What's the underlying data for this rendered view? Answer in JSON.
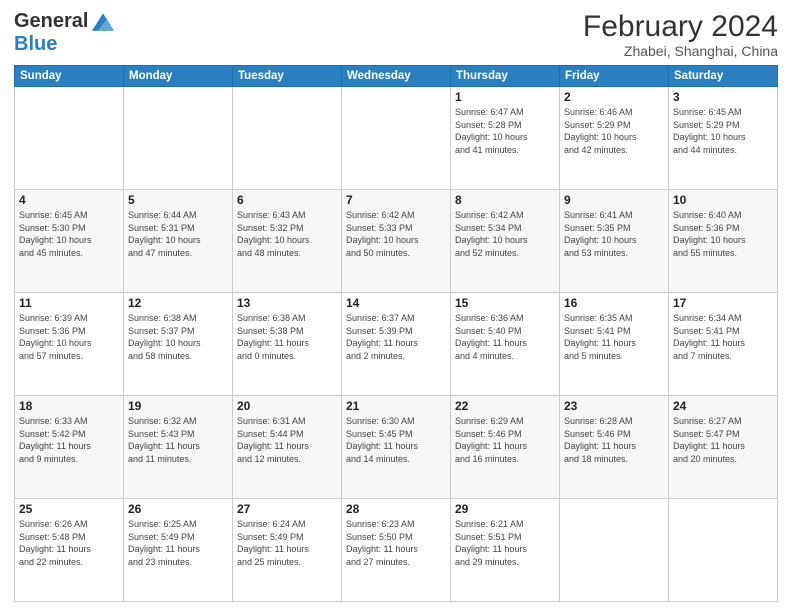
{
  "header": {
    "logo_general": "General",
    "logo_blue": "Blue",
    "month_title": "February 2024",
    "location": "Zhabei, Shanghai, China"
  },
  "days_of_week": [
    "Sunday",
    "Monday",
    "Tuesday",
    "Wednesday",
    "Thursday",
    "Friday",
    "Saturday"
  ],
  "weeks": [
    [
      {
        "day": "",
        "info": ""
      },
      {
        "day": "",
        "info": ""
      },
      {
        "day": "",
        "info": ""
      },
      {
        "day": "",
        "info": ""
      },
      {
        "day": "1",
        "info": "Sunrise: 6:47 AM\nSunset: 5:28 PM\nDaylight: 10 hours\nand 41 minutes."
      },
      {
        "day": "2",
        "info": "Sunrise: 6:46 AM\nSunset: 5:29 PM\nDaylight: 10 hours\nand 42 minutes."
      },
      {
        "day": "3",
        "info": "Sunrise: 6:45 AM\nSunset: 5:29 PM\nDaylight: 10 hours\nand 44 minutes."
      }
    ],
    [
      {
        "day": "4",
        "info": "Sunrise: 6:45 AM\nSunset: 5:30 PM\nDaylight: 10 hours\nand 45 minutes."
      },
      {
        "day": "5",
        "info": "Sunrise: 6:44 AM\nSunset: 5:31 PM\nDaylight: 10 hours\nand 47 minutes."
      },
      {
        "day": "6",
        "info": "Sunrise: 6:43 AM\nSunset: 5:32 PM\nDaylight: 10 hours\nand 48 minutes."
      },
      {
        "day": "7",
        "info": "Sunrise: 6:42 AM\nSunset: 5:33 PM\nDaylight: 10 hours\nand 50 minutes."
      },
      {
        "day": "8",
        "info": "Sunrise: 6:42 AM\nSunset: 5:34 PM\nDaylight: 10 hours\nand 52 minutes."
      },
      {
        "day": "9",
        "info": "Sunrise: 6:41 AM\nSunset: 5:35 PM\nDaylight: 10 hours\nand 53 minutes."
      },
      {
        "day": "10",
        "info": "Sunrise: 6:40 AM\nSunset: 5:36 PM\nDaylight: 10 hours\nand 55 minutes."
      }
    ],
    [
      {
        "day": "11",
        "info": "Sunrise: 6:39 AM\nSunset: 5:36 PM\nDaylight: 10 hours\nand 57 minutes."
      },
      {
        "day": "12",
        "info": "Sunrise: 6:38 AM\nSunset: 5:37 PM\nDaylight: 10 hours\nand 58 minutes."
      },
      {
        "day": "13",
        "info": "Sunrise: 6:38 AM\nSunset: 5:38 PM\nDaylight: 11 hours\nand 0 minutes."
      },
      {
        "day": "14",
        "info": "Sunrise: 6:37 AM\nSunset: 5:39 PM\nDaylight: 11 hours\nand 2 minutes."
      },
      {
        "day": "15",
        "info": "Sunrise: 6:36 AM\nSunset: 5:40 PM\nDaylight: 11 hours\nand 4 minutes."
      },
      {
        "day": "16",
        "info": "Sunrise: 6:35 AM\nSunset: 5:41 PM\nDaylight: 11 hours\nand 5 minutes."
      },
      {
        "day": "17",
        "info": "Sunrise: 6:34 AM\nSunset: 5:41 PM\nDaylight: 11 hours\nand 7 minutes."
      }
    ],
    [
      {
        "day": "18",
        "info": "Sunrise: 6:33 AM\nSunset: 5:42 PM\nDaylight: 11 hours\nand 9 minutes."
      },
      {
        "day": "19",
        "info": "Sunrise: 6:32 AM\nSunset: 5:43 PM\nDaylight: 11 hours\nand 11 minutes."
      },
      {
        "day": "20",
        "info": "Sunrise: 6:31 AM\nSunset: 5:44 PM\nDaylight: 11 hours\nand 12 minutes."
      },
      {
        "day": "21",
        "info": "Sunrise: 6:30 AM\nSunset: 5:45 PM\nDaylight: 11 hours\nand 14 minutes."
      },
      {
        "day": "22",
        "info": "Sunrise: 6:29 AM\nSunset: 5:46 PM\nDaylight: 11 hours\nand 16 minutes."
      },
      {
        "day": "23",
        "info": "Sunrise: 6:28 AM\nSunset: 5:46 PM\nDaylight: 11 hours\nand 18 minutes."
      },
      {
        "day": "24",
        "info": "Sunrise: 6:27 AM\nSunset: 5:47 PM\nDaylight: 11 hours\nand 20 minutes."
      }
    ],
    [
      {
        "day": "25",
        "info": "Sunrise: 6:26 AM\nSunset: 5:48 PM\nDaylight: 11 hours\nand 22 minutes."
      },
      {
        "day": "26",
        "info": "Sunrise: 6:25 AM\nSunset: 5:49 PM\nDaylight: 11 hours\nand 23 minutes."
      },
      {
        "day": "27",
        "info": "Sunrise: 6:24 AM\nSunset: 5:49 PM\nDaylight: 11 hours\nand 25 minutes."
      },
      {
        "day": "28",
        "info": "Sunrise: 6:23 AM\nSunset: 5:50 PM\nDaylight: 11 hours\nand 27 minutes."
      },
      {
        "day": "29",
        "info": "Sunrise: 6:21 AM\nSunset: 5:51 PM\nDaylight: 11 hours\nand 29 minutes."
      },
      {
        "day": "",
        "info": ""
      },
      {
        "day": "",
        "info": ""
      }
    ]
  ]
}
